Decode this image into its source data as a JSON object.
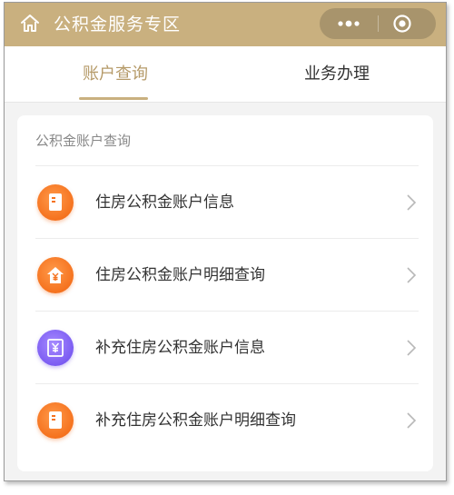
{
  "header": {
    "title": "公积金服务专区",
    "home_icon": "home-icon",
    "more_icon": "more-dots-icon",
    "target_icon": "target-icon"
  },
  "tabs": [
    {
      "label": "账户查询",
      "active": true
    },
    {
      "label": "业务办理",
      "active": false
    }
  ],
  "section": {
    "title": "公积金账户查询",
    "items": [
      {
        "label": "住房公积金账户信息",
        "icon": "document-icon",
        "color": "#f5721e"
      },
      {
        "label": "住房公积金账户明细查询",
        "icon": "house-yen-icon",
        "color": "#f5721e"
      },
      {
        "label": "补充住房公积金账户信息",
        "icon": "frame-yen-icon",
        "color": "#7b5cf2"
      },
      {
        "label": "补充住房公积金账户明细查询",
        "icon": "document-icon",
        "color": "#f5721e"
      }
    ]
  },
  "colors": {
    "brand": "#c9b07f",
    "accent_text": "#b59a68",
    "orange": "#f5721e",
    "purple": "#7b5cf2"
  }
}
